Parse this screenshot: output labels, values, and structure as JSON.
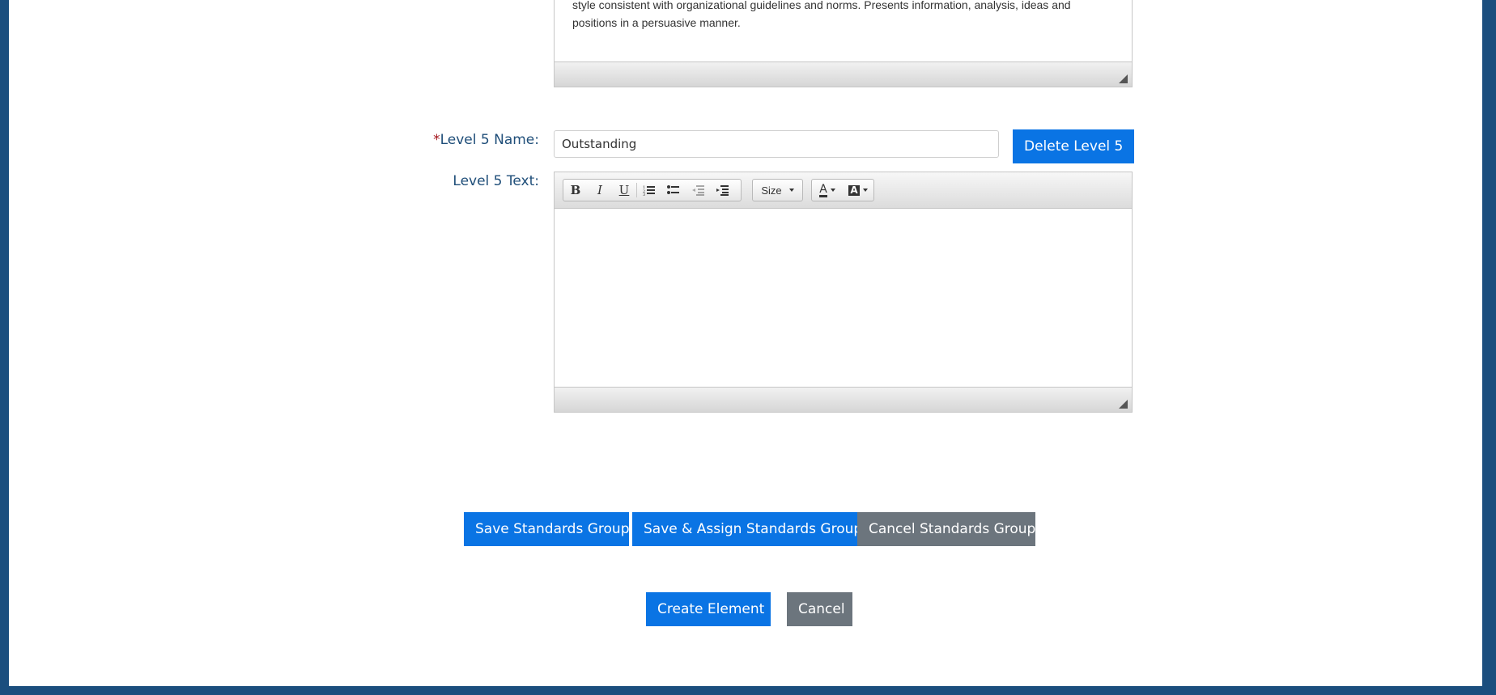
{
  "previous_editor": {
    "text_line1": "style consistent with organizational guidelines and norms. Presents information, analysis, ideas and",
    "text_line2": "positions in a persuasive manner."
  },
  "level5": {
    "name_label_required_mark": "*",
    "name_label": "Level 5 Name:",
    "name_value": "Outstanding",
    "delete_button": "Delete Level 5",
    "text_label": "Level 5 Text:",
    "text_value": ""
  },
  "toolbar": {
    "size_label": "Size"
  },
  "actions": {
    "save_group": "Save Standards Group",
    "save_assign_group": "Save & Assign Standards Group",
    "cancel_group": "Cancel Standards Group",
    "create_element": "Create Element",
    "cancel": "Cancel"
  },
  "colors": {
    "frame": "#1b4e7e",
    "label": "#1f4e79",
    "required": "#a3131a",
    "primary": "#0a74e4",
    "secondary": "#6c757d"
  }
}
